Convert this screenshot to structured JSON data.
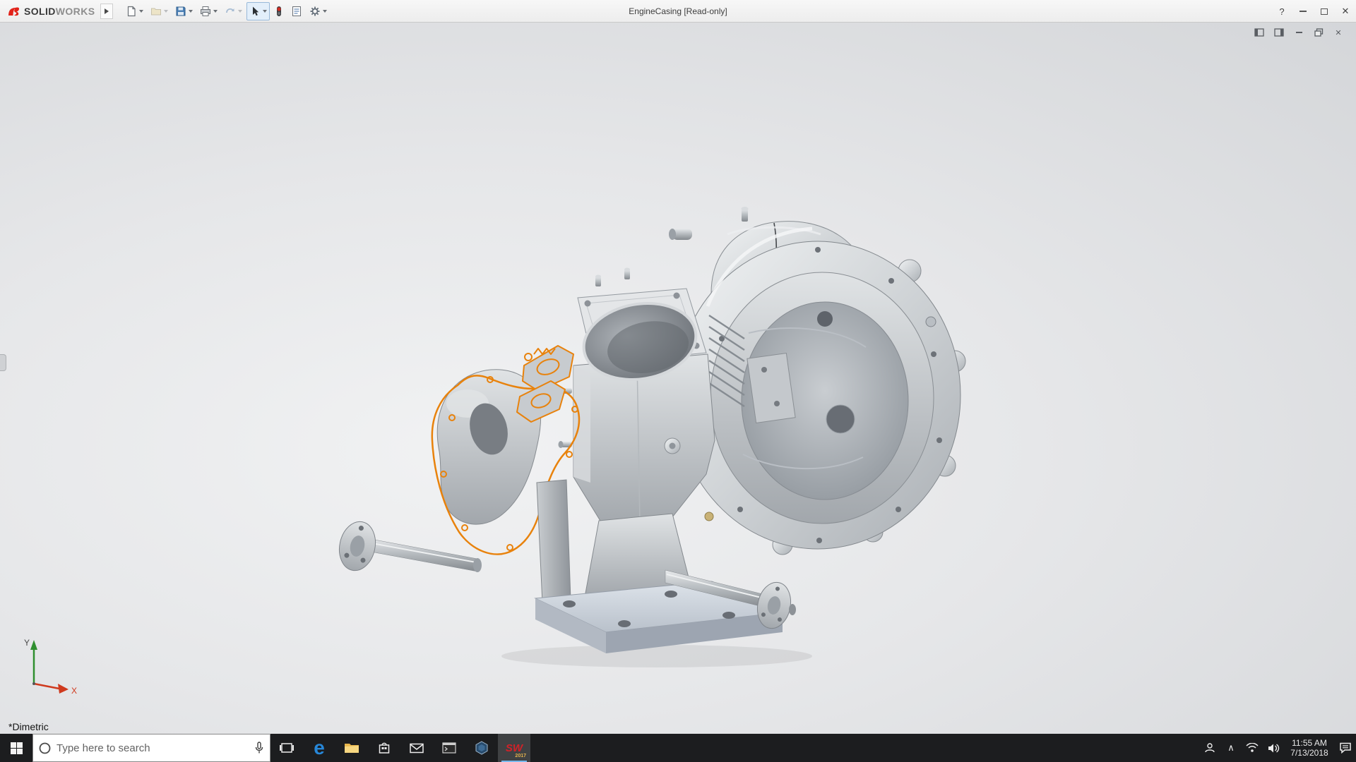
{
  "titlebar": {
    "brand_bold": "SOLID",
    "brand_light": "WORKS",
    "title": "EngineCasing [Read-only]",
    "help_glyph": "?",
    "close_glyph": "✕"
  },
  "doc_window": {
    "close_glyph": "✕"
  },
  "viewport": {
    "orientation_label": "*Dimetric",
    "triad": {
      "x": "X",
      "y": "Y"
    }
  },
  "taskbar": {
    "search_placeholder": "Type here to search",
    "edge_glyph": "e",
    "sw_label": "SW",
    "sw_year": "2017",
    "tray_chevron": "∧",
    "time": "11:55 AM",
    "date": "7/13/2018"
  },
  "colors": {
    "brand_red": "#e2231a",
    "highlight_orange": "#e8820c",
    "taskbar_bg": "#1c1d1f",
    "titlebar_bg": "#f0f0f0"
  }
}
